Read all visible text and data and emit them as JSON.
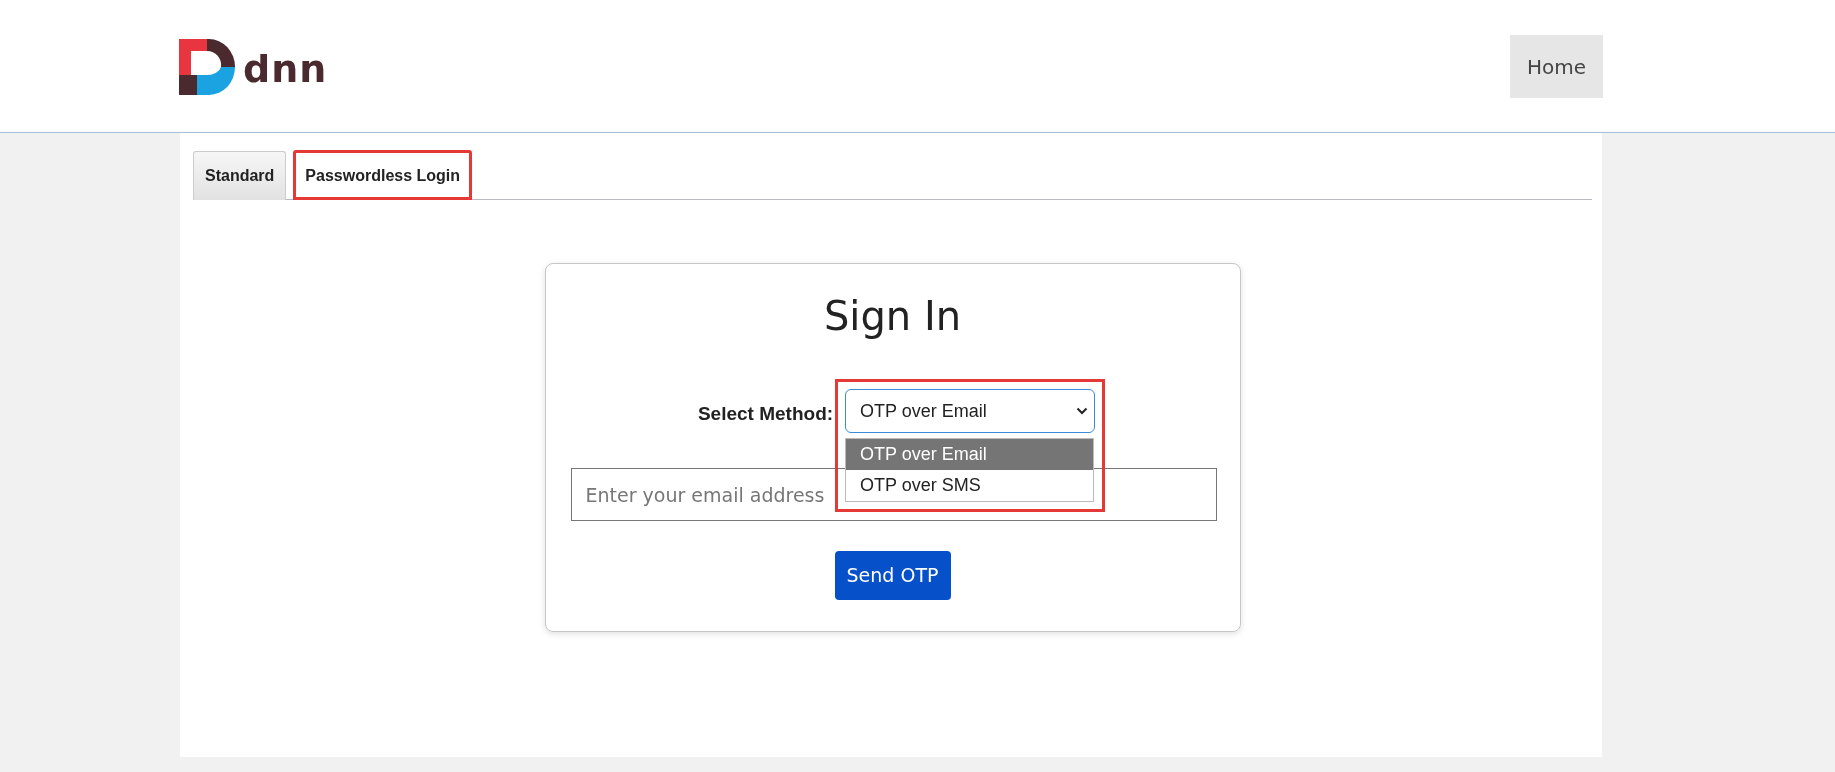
{
  "header": {
    "logo_text": "dnn",
    "nav": [
      {
        "label": "Home",
        "selected": true
      }
    ]
  },
  "tabs": [
    {
      "label": "Standard",
      "selected": false,
      "highlighted": false
    },
    {
      "label": "Passwordless Login",
      "selected": true,
      "highlighted": true
    }
  ],
  "signin": {
    "title": "Sign In",
    "method_label": "Select Method:",
    "method_select": {
      "value": "OTP over Email",
      "expanded": true,
      "highlighted": true,
      "options": [
        {
          "label": "OTP over Email",
          "selected": true
        },
        {
          "label": "OTP over SMS",
          "selected": false
        }
      ]
    },
    "email": {
      "placeholder": "Enter your email address"
    },
    "button": "Send OTP"
  }
}
